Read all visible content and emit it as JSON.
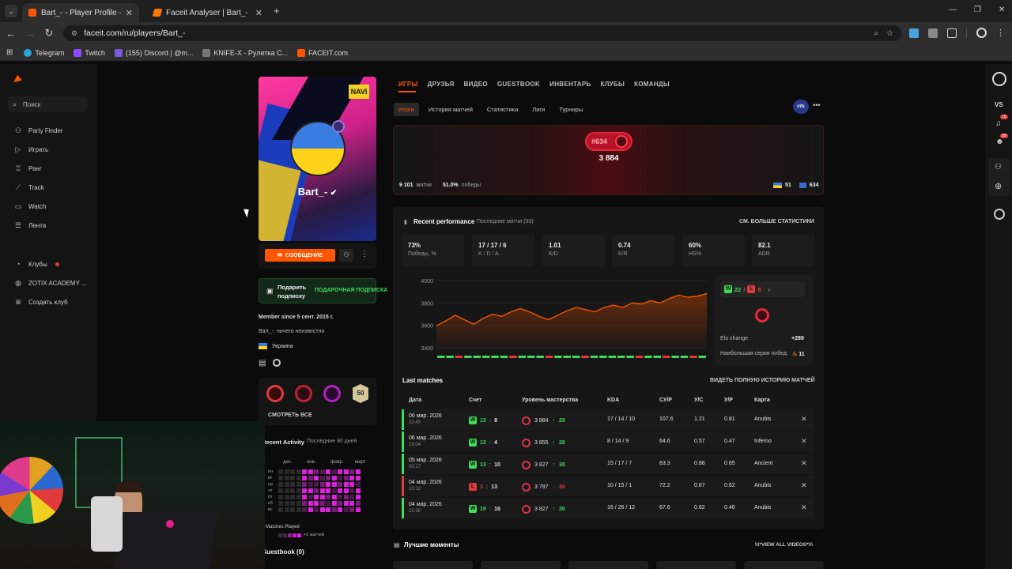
{
  "browser": {
    "tabs": [
      {
        "title": "Bart_- - Player Profile - FACEIT.c"
      },
      {
        "title": "Faceit Analyser | Bart_-"
      }
    ],
    "new_tab": "+",
    "url": "faceit.com/ru/players/Bart_-",
    "bookmarks": [
      "Telegram",
      "Twitch",
      "(155) Discord | @m...",
      "KNIFE-X - Рулетка С...",
      "FACEIT.com"
    ]
  },
  "sidebar": {
    "search_placeholder": "Поиск",
    "items": [
      "Party Finder",
      "Играть",
      "Ранг",
      "Track",
      "Watch",
      "Лента"
    ],
    "club_items": [
      "Клубы",
      "ZOTIX ACADEMY ...",
      "Создать клуб"
    ]
  },
  "rightbar": {
    "vs": "VS",
    "badge1": "15",
    "badge2": "59"
  },
  "profile": {
    "username": "Bart_-",
    "message_button": "СООБЩЕНИЕ",
    "gift_line1": "Подарить",
    "gift_line2": "подписку",
    "gift_badge": "ПОДАРОЧНАЯ ПОДПИСКА",
    "member_since": "Member since 5 сент. 2015 г.",
    "bio": "Bart_-: ничего неизвестно",
    "country": "Украина",
    "badges_see_all": "СМОТРЕТЬ ВСЕ",
    "badge_50": "50",
    "recent_activity_title": "Recent Activity",
    "recent_activity_sub": "Последние 90 дней",
    "months": [
      "дек.",
      "янв.",
      "февр.",
      "март"
    ],
    "weekdays": [
      "пн",
      "вт",
      "ср",
      "чт",
      "пт",
      "сб",
      "вс"
    ],
    "matches_played": "8 Matches Played",
    "legend_more": "+5 матчей",
    "guestbook": "Guestbook (0)"
  },
  "main_tabs": [
    "ИГРЫ",
    "ДРУЗЬЯ",
    "ВИДЕО",
    "GUESTBOOK",
    "ИНВЕНТАРЬ",
    "КЛУБЫ",
    "КОМАНДЫ"
  ],
  "sub_tabs": [
    "Итоги",
    "История матчей",
    "Статистика",
    "Лиги",
    "Турниры"
  ],
  "game_badge": "cts",
  "elo_card": {
    "rank": "#634",
    "elo": "3 884",
    "matches_value": "9 101",
    "matches_label": "матчи",
    "wins_value": "51.0%",
    "wins_label": "победы",
    "country_rank": "51",
    "region_rank": "634"
  },
  "performance": {
    "title": "Recent performance",
    "subtitle": "Последние матчи (30)",
    "more_link": "СМ. БОЛЬШЕ СТАТИСТИКИ",
    "stats": [
      {
        "value": "73%",
        "label": "Победы, %"
      },
      {
        "value": "17 / 17 / 6",
        "label": "K / D / A"
      },
      {
        "value": "1.01",
        "label": "K/D"
      },
      {
        "value": "0.74",
        "label": "K/R"
      },
      {
        "value": "60%",
        "label": "HS%"
      },
      {
        "value": "82.1",
        "label": "ADR"
      }
    ],
    "wins": "22",
    "losses": "8",
    "elo_change_label": "Elo change",
    "elo_change_value": "+289",
    "streak_label": "Наибольшая серия побед",
    "streak_value": "11"
  },
  "chart_data": {
    "type": "line",
    "title": "",
    "xlabel": "",
    "ylabel": "",
    "ylim": [
      3350,
      4000
    ],
    "yticks": [
      3400,
      3600,
      3800,
      4000
    ],
    "series": [
      {
        "values": [
          3595,
          3640,
          3690,
          3650,
          3610,
          3660,
          3700,
          3680,
          3720,
          3750,
          3720,
          3680,
          3650,
          3690,
          3730,
          3760,
          3740,
          3720,
          3760,
          3780,
          3760,
          3800,
          3790,
          3820,
          3800,
          3840,
          3870,
          3850,
          3860,
          3884
        ]
      }
    ],
    "results": [
      "W",
      "W",
      "L",
      "W",
      "W",
      "W",
      "W",
      "W",
      "L",
      "W",
      "W",
      "W",
      "L",
      "W",
      "W",
      "W",
      "L",
      "W",
      "W",
      "W",
      "W",
      "W",
      "L",
      "W",
      "W",
      "L",
      "W",
      "W",
      "L",
      "W"
    ]
  },
  "last_matches": {
    "title": "Last matches",
    "link": "ВИДЕТЬ ПОЛНУЮ ИСТОРИЮ МАТЧЕЙ",
    "columns": [
      "Дата",
      "Счет",
      "Уровень мастерства",
      "KDA",
      "СУ/Р",
      "У/С",
      "У/Р",
      "Карта"
    ],
    "rows": [
      {
        "date": "06 мар. 2026",
        "time": "22:45",
        "result": "W",
        "score_a": "13",
        "score_b": "8",
        "elo": "3 884",
        "delta": "29",
        "kda": "17 / 14 / 10",
        "adr": "107.6",
        "kd": "1.21",
        "kr": "0.81",
        "map": "Anubis"
      },
      {
        "date": "06 мар. 2026",
        "time": "15:04",
        "result": "W",
        "score_a": "13",
        "score_b": "4",
        "elo": "3 855",
        "delta": "28",
        "kda": "8 / 14 / 9",
        "adr": "64.6",
        "kd": "0.57",
        "kr": "0.47",
        "map": "Inferno"
      },
      {
        "date": "05 мар. 2026",
        "time": "00:17",
        "result": "W",
        "score_a": "13",
        "score_b": "10",
        "elo": "3 827",
        "delta": "30",
        "kda": "15 / 17 / 7",
        "adr": "83.3",
        "kd": "0.88",
        "kr": "0.65",
        "map": "Ancient"
      },
      {
        "date": "04 мар. 2026",
        "time": "23:12",
        "result": "L",
        "score_a": "3",
        "score_b": "13",
        "elo": "3 797",
        "delta": "30",
        "kda": "10 / 15 / 1",
        "adr": "72.2",
        "kd": "0.67",
        "kr": "0.62",
        "map": "Anubis"
      },
      {
        "date": "04 мар. 2026",
        "time": "22:38",
        "result": "W",
        "score_a": "19",
        "score_b": "16",
        "elo": "3 827",
        "delta": "30",
        "kda": "16 / 26 / 12",
        "adr": "67.6",
        "kd": "0.62",
        "kr": "0.46",
        "map": "Anubis"
      }
    ]
  },
  "highlights": {
    "title": "Лучшие моменты",
    "link": "\\\\\\*VIEW ALL VIDEOS*\\\\\\"
  },
  "colors": {
    "accent": "#ff5500",
    "win": "#3ddc5a",
    "loss": "#e23a3a",
    "activity": "#e020e0"
  }
}
